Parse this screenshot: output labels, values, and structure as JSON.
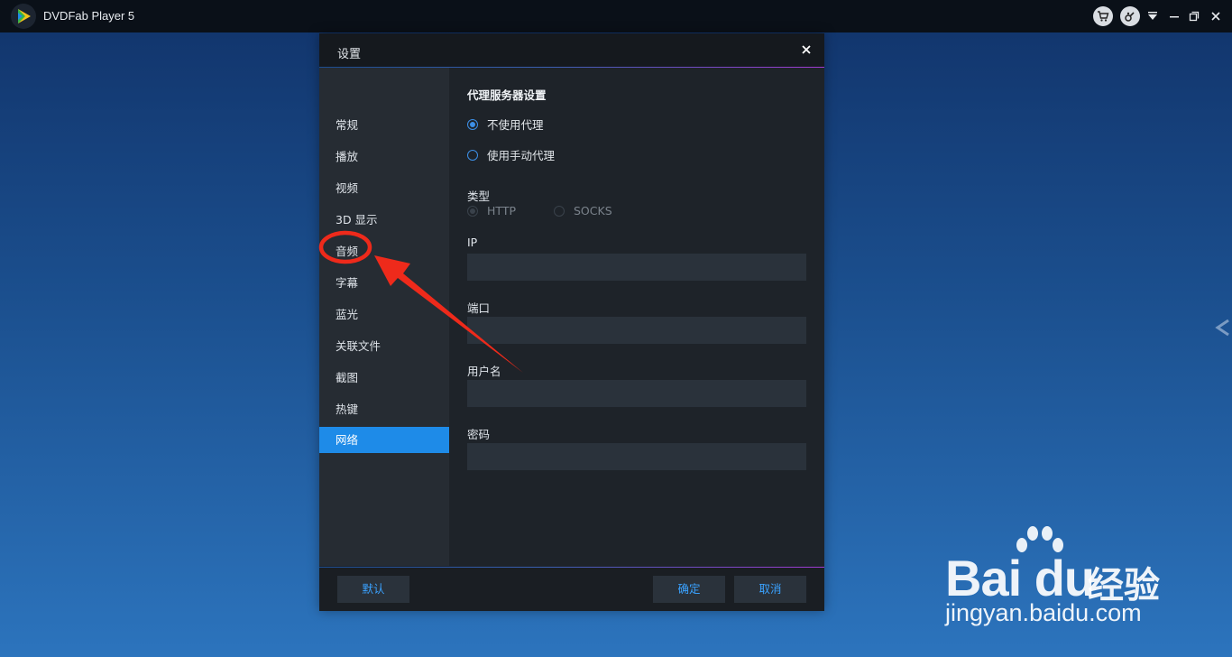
{
  "app": {
    "title": "DVDFab Player 5"
  },
  "dialog": {
    "title": "设置",
    "sidebar": [
      {
        "label": "常规"
      },
      {
        "label": "播放"
      },
      {
        "label": "视频"
      },
      {
        "label": "3D 显示"
      },
      {
        "label": "音频"
      },
      {
        "label": "字幕"
      },
      {
        "label": "蓝光"
      },
      {
        "label": "关联文件"
      },
      {
        "label": "截图"
      },
      {
        "label": "热键"
      },
      {
        "label": "网络",
        "selected": true
      }
    ],
    "proxy": {
      "section_title": "代理服务器设置",
      "option_none": "不使用代理",
      "option_manual": "使用手动代理",
      "selected": "不使用代理",
      "type_label": "类型",
      "type_http": "HTTP",
      "type_socks": "SOCKS",
      "type_selected": "HTTP",
      "ip_label": "IP",
      "ip_value": "",
      "port_label": "端口",
      "port_value": "",
      "username_label": "用户名",
      "username_value": "",
      "password_label": "密码",
      "password_value": ""
    },
    "footer": {
      "default_label": "默认",
      "ok_label": "确定",
      "cancel_label": "取消"
    }
  },
  "watermark": {
    "brand": "Bai du",
    "brand_cn": "经验",
    "url": "jingyan.baidu.com"
  },
  "colors": {
    "accent": "#1e8be8",
    "annotation": "#ee2a1b",
    "link_text": "#3aa2ff"
  },
  "icons": [
    "app-logo-icon",
    "cart-icon",
    "settings-icon",
    "dropdown-icon",
    "minimize-icon",
    "restore-icon",
    "close-icon",
    "collapse-arrow-icon"
  ]
}
